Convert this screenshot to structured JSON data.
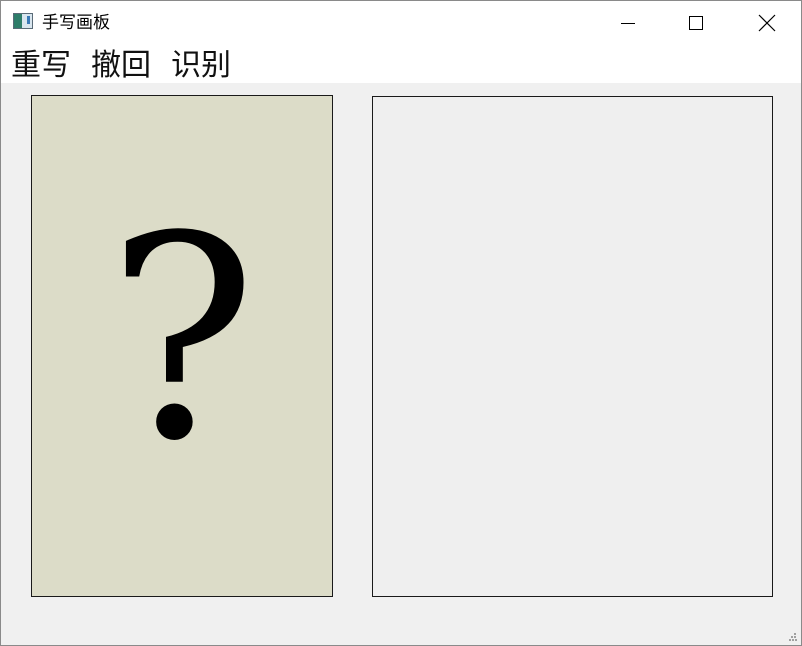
{
  "window": {
    "title": "手写画板"
  },
  "menu": {
    "items": [
      {
        "label": "重写"
      },
      {
        "label": "撤回"
      },
      {
        "label": "识别"
      }
    ]
  },
  "result": {
    "glyph": "?",
    "background": "#dcdcc8"
  },
  "colors": {
    "canvas": "#efefef",
    "client": "#f0f0f0"
  },
  "icons": {
    "app": "app-icon",
    "minimize": "minimize-icon",
    "maximize": "maximize-icon",
    "close": "close-icon",
    "grip": "size-grip-icon"
  }
}
